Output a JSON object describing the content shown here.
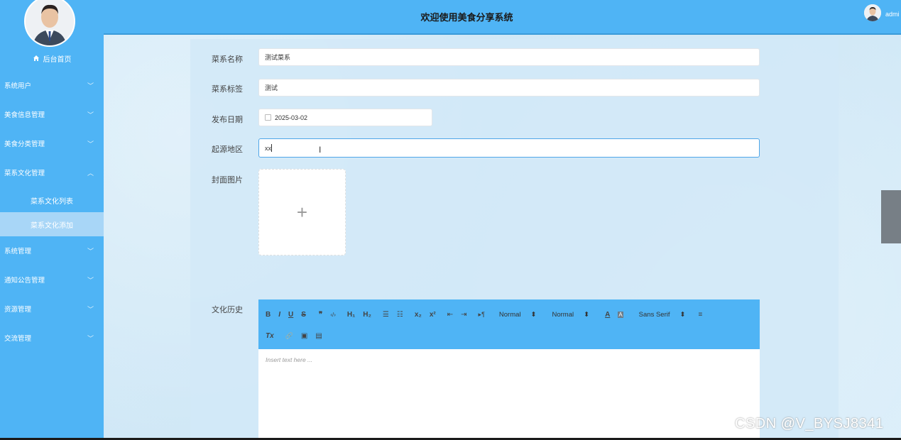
{
  "header": {
    "title": "欢迎使用美食分享系统",
    "username": "admi"
  },
  "sidebar": {
    "home": "后台首页",
    "menu": [
      {
        "label": "系统用户",
        "chevron": "﹀"
      },
      {
        "label": "美食信息管理",
        "chevron": "﹀"
      },
      {
        "label": "美食分类管理",
        "chevron": "﹀"
      },
      {
        "label": "菜系文化管理",
        "chevron": "︿"
      },
      {
        "label": "系统管理",
        "chevron": "﹀"
      },
      {
        "label": "通知公告管理",
        "chevron": "﹀"
      },
      {
        "label": "资源管理",
        "chevron": "﹀"
      },
      {
        "label": "交流管理",
        "chevron": "﹀"
      }
    ],
    "submenu": [
      {
        "label": "菜系文化列表"
      },
      {
        "label": "菜系文化添加"
      }
    ]
  },
  "form": {
    "name_label": "菜系名称",
    "name_value": "测试菜系",
    "tag_label": "菜系标签",
    "tag_value": "测试",
    "date_label": "发布日期",
    "date_value": "2025-03-02",
    "origin_label": "起源地区",
    "origin_value": "xx",
    "cover_label": "封面图片",
    "upload_plus": "+",
    "history_label": "文化历史"
  },
  "editor": {
    "placeholder": "Insert text here ...",
    "toolbar_row1": [
      "B",
      "I",
      "U",
      "S",
      "❞",
      "‹/›",
      "H₁",
      "H₂",
      "☰",
      "☷",
      "x₂",
      "x²",
      "⇤",
      "⇥",
      "▸¶"
    ],
    "select_size1": "Normal",
    "select_size2": "Normal",
    "select_font": "Sans Serif",
    "select_arrow": "⬍",
    "color_a": "A",
    "bg_a": "A",
    "align": "≡",
    "toolbar_row2": [
      "Tx",
      "🔗",
      "▣",
      "▤"
    ]
  },
  "watermark": "CSDN @V_BYSJ8341",
  "cursor_glyph": "I"
}
